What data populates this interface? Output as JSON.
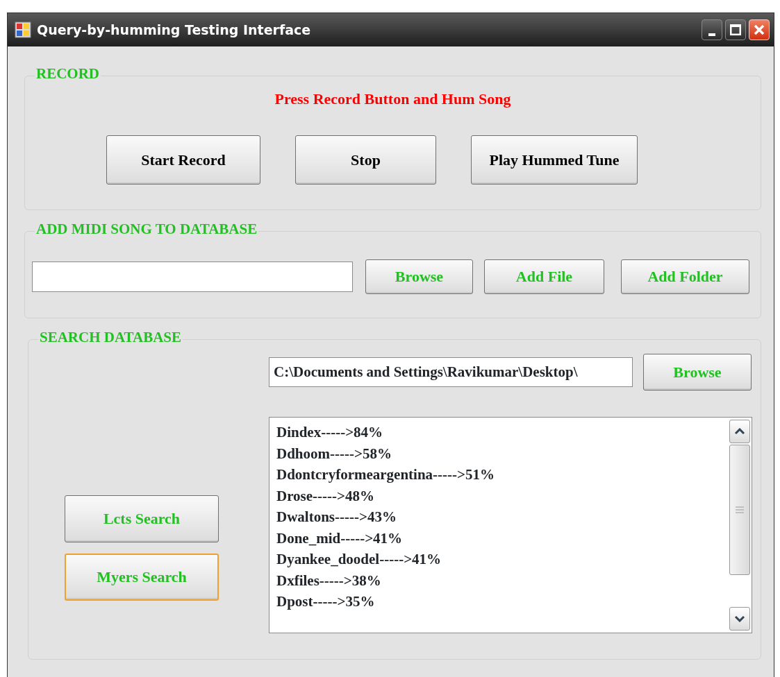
{
  "window": {
    "title": "Query-by-humming Testing Interface",
    "controls": [
      {
        "kind": "minimize"
      },
      {
        "kind": "maximize"
      },
      {
        "kind": "close"
      }
    ]
  },
  "record": {
    "legend": "RECORD",
    "instruction": "Press Record Button and Hum Song",
    "buttons": [
      {
        "label": "Start Record"
      },
      {
        "label": "Stop"
      },
      {
        "label": "Play Hummed Tune"
      }
    ]
  },
  "add_midi": {
    "legend": "ADD MIDI SONG TO DATABASE",
    "buttons": [
      {
        "label": "Browse"
      },
      {
        "label": "Add File"
      },
      {
        "label": "Add Folder"
      }
    ]
  },
  "search": {
    "legend": "SEARCH DATABASE",
    "path": "C:\\Documents and Settings\\Ravikumar\\Desktop\\",
    "browse": "Browse",
    "buttons": [
      {
        "label": "Lcts Search",
        "focused": false
      },
      {
        "label": "Myers Search",
        "focused": true
      }
    ],
    "results": [
      "Dindex----->84%",
      "Ddhoom----->58%",
      "Ddontcryformeargentina----->51%",
      "Drose----->48%",
      "Dwaltons----->43%",
      "Done_mid----->41%",
      "Dyankee_doodel----->41%",
      "Dxfiles----->38%",
      "Dpost----->35%"
    ]
  }
}
